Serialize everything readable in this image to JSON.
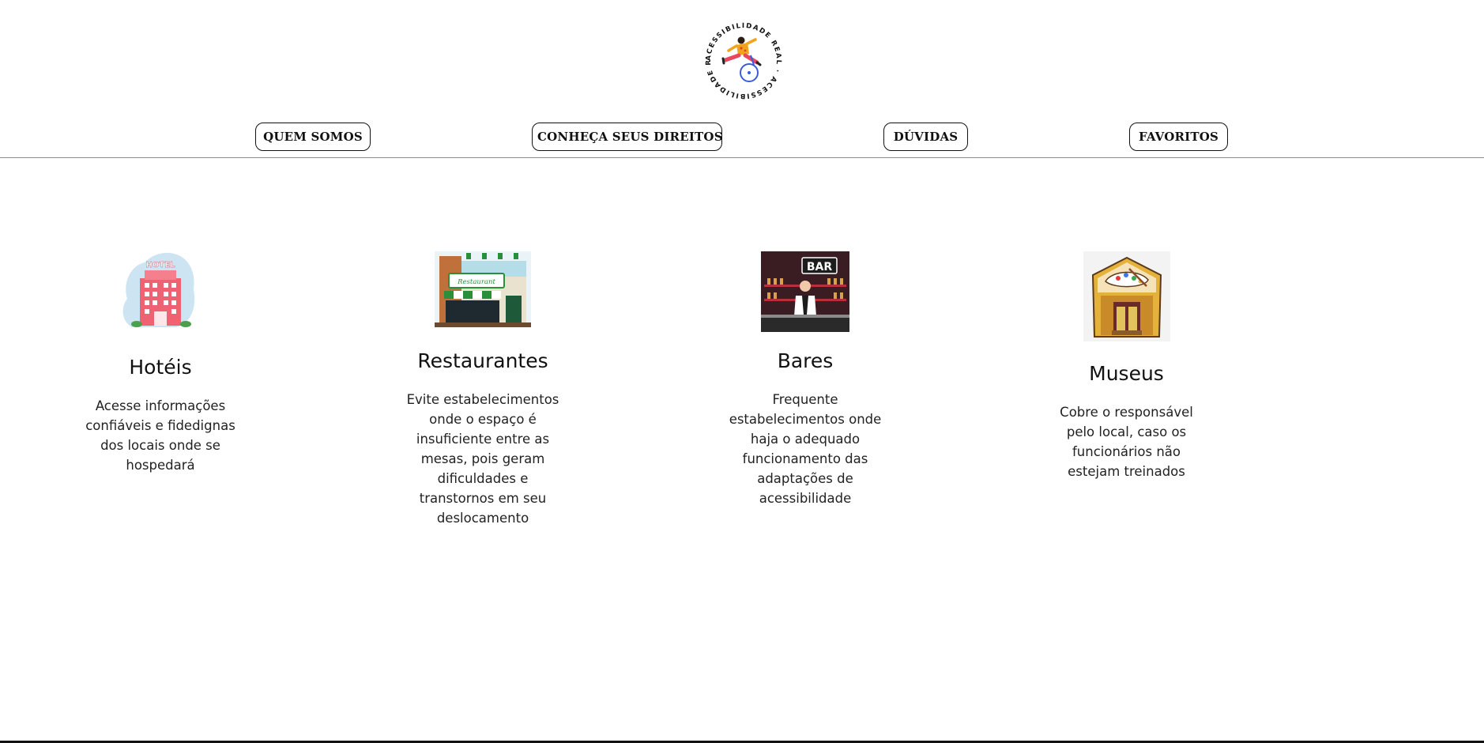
{
  "header": {
    "logo_text": "ACESSIBILIDADE REAL · ACESSIBILIDADE REAL ·",
    "nav": [
      {
        "label": "QUEM SOMOS"
      },
      {
        "label": "CONHEÇA SEUS DIREITOS"
      },
      {
        "label": "DÚVIDAS"
      },
      {
        "label": "FAVORITOS"
      }
    ]
  },
  "cards": [
    {
      "title": "Hotéis",
      "description": "Acesse informações confiáveis e fidedignas dos locais onde se hospedará",
      "image_sign": "HOTEL"
    },
    {
      "title": "Restaurantes",
      "description": "Evite estabelecimentos onde o espaço é insuficiente entre as mesas, pois geram dificuldades e transtornos em seu deslocamento",
      "image_sign": "Restaurant"
    },
    {
      "title": "Bares",
      "description": "Frequente estabelecimentos onde haja o adequado funcionamento das adaptações de acessibilidade",
      "image_sign": "BAR"
    },
    {
      "title": "Museus",
      "description": "Cobre o responsável pelo local, caso os funcionários não estejam treinados",
      "image_sign": ""
    }
  ],
  "colors": {
    "accent": "#111111",
    "background": "#ffffff",
    "divider": "#8a8a8a"
  },
  "icons": [
    "wheelchair-dancer-logo",
    "hotel-icon",
    "restaurant-icon",
    "bar-icon",
    "museum-icon"
  ]
}
